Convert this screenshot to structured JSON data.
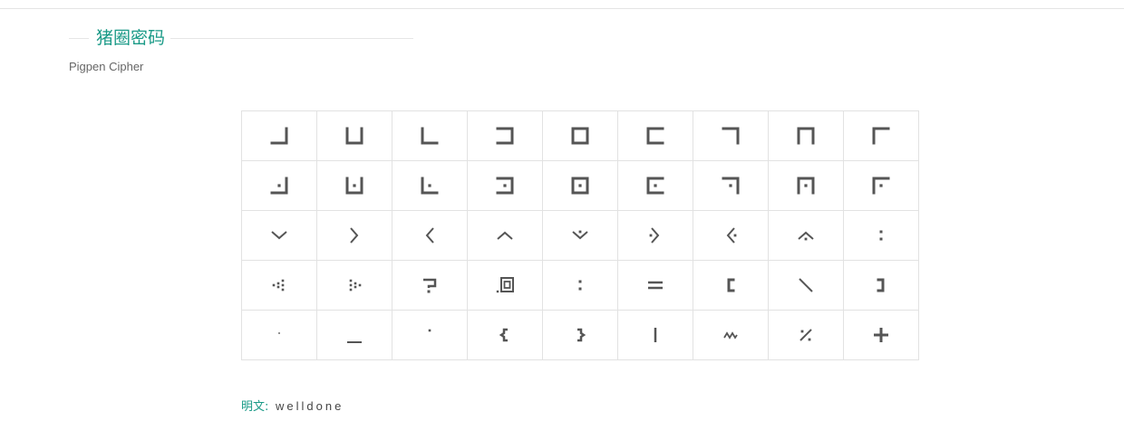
{
  "section": {
    "title": "猪圈密码",
    "subtitle": "Pigpen Cipher"
  },
  "cipher_grid": {
    "rows": [
      [
        "pigpen-grid-1",
        "pigpen-grid-2",
        "pigpen-grid-3",
        "pigpen-grid-4",
        "pigpen-grid-5",
        "pigpen-grid-6",
        "pigpen-grid-7",
        "pigpen-grid-8",
        "pigpen-grid-9"
      ],
      [
        "pigpen-grid-dot-1",
        "pigpen-grid-dot-2",
        "pigpen-grid-dot-3",
        "pigpen-grid-dot-4",
        "pigpen-grid-dot-5",
        "pigpen-grid-dot-6",
        "pigpen-grid-dot-7",
        "pigpen-grid-dot-8",
        "pigpen-grid-dot-9"
      ],
      [
        "pigpen-x-bottom",
        "pigpen-x-left",
        "pigpen-x-right",
        "pigpen-x-top",
        "pigpen-x-dot-bottom",
        "pigpen-x-dot-left",
        "pigpen-x-dot-right",
        "pigpen-x-dot-top",
        "colon-symbol"
      ],
      [
        "dot-cluster-left-symbol",
        "dot-cluster-right-symbol",
        "question-symbol",
        "dot-box-symbol",
        "colon-symbol",
        "equals-symbol",
        "left-bracket-symbol",
        "backslash-symbol",
        "right-bracket-symbol"
      ],
      [
        "small-dot-symbol",
        "underscore-symbol",
        "dot-symbol",
        "left-brace-symbol",
        "right-brace-symbol",
        "pipe-symbol",
        "tilde-symbol",
        "percent-symbol",
        "plus-symbol"
      ]
    ]
  },
  "plaintext": {
    "label": "明文:",
    "value": "welldone"
  },
  "colors": {
    "accent": "#1a9a87",
    "glyph": "#555555",
    "border": "#e2e2e2"
  }
}
